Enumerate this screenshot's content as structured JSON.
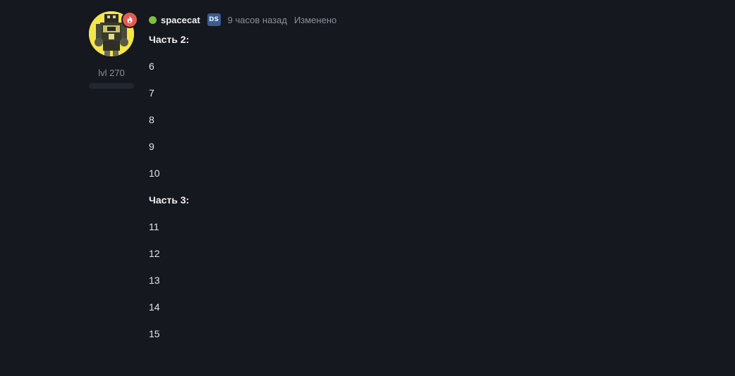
{
  "author": {
    "username": "spacecat",
    "tag": "DS",
    "level": "lvl 270",
    "xp_fraction": 0
  },
  "post_meta": {
    "time": "9 часов назад",
    "edited": "Изменено"
  },
  "post_body": {
    "lines": [
      {
        "text": "Часть 2:",
        "heading": true
      },
      {
        "text": "6",
        "heading": false
      },
      {
        "text": "7",
        "heading": false
      },
      {
        "text": "8",
        "heading": false
      },
      {
        "text": "9",
        "heading": false
      },
      {
        "text": "10",
        "heading": false
      },
      {
        "text": "Часть 3:",
        "heading": true
      },
      {
        "text": "11",
        "heading": false
      },
      {
        "text": "12",
        "heading": false
      },
      {
        "text": "13",
        "heading": false
      },
      {
        "text": "14",
        "heading": false
      },
      {
        "text": "15",
        "heading": false
      }
    ]
  },
  "colors": {
    "background": "#15181e",
    "online": "#7cc23a",
    "badge": "#e85a4f",
    "tag": "#3c5c8c",
    "avatar_bg": "#f4e64a"
  },
  "icons": {
    "badge": "flame-icon",
    "online": "online-status-icon"
  }
}
